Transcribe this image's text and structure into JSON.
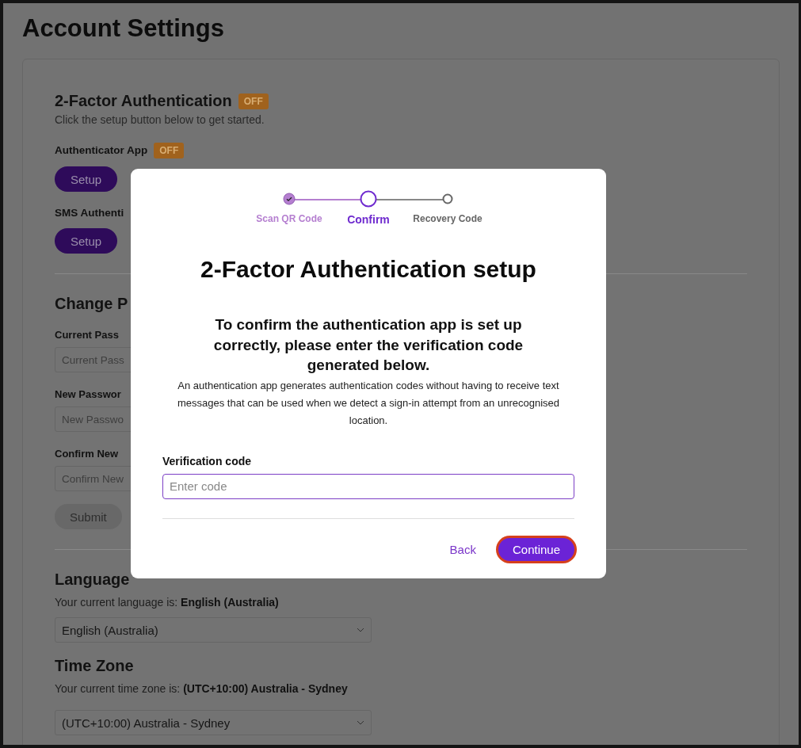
{
  "page_title": "Account Settings",
  "two_factor": {
    "title": "2-Factor Authentication",
    "status": "OFF",
    "hint": "Click the setup button below to get started.",
    "methods": [
      {
        "label": "Authenticator App",
        "status": "OFF",
        "button": "Setup"
      },
      {
        "label": "SMS Authenti",
        "button": "Setup"
      }
    ]
  },
  "change_password": {
    "title": "Change P",
    "fields": [
      {
        "label": "Current Pass",
        "placeholder": "Current Pass"
      },
      {
        "label": "New Passwor",
        "placeholder": "New Passwo"
      },
      {
        "label": "Confirm New",
        "placeholder": "Confirm New"
      }
    ],
    "submit": {
      "label": "Submit",
      "disabled": true
    }
  },
  "language": {
    "title": "Language",
    "current_prefix": "Your current language is:",
    "current": "English (Australia)",
    "value": "English (Australia)"
  },
  "time_zone": {
    "title": "Time Zone",
    "current_prefix": "Your current time zone is:",
    "current": "(UTC+10:00) Australia - Sydney",
    "value": "(UTC+10:00) Australia - Sydney"
  },
  "modal": {
    "steps": [
      {
        "label": "Scan QR Code",
        "completed": true,
        "selected": false
      },
      {
        "label": "Confirm",
        "completed": false,
        "selected": true
      },
      {
        "label": "Recovery Code",
        "completed": false,
        "selected": false
      }
    ],
    "title": "2-Factor Authentication setup",
    "lead": "To confirm the authentication app is set up correctly, please enter the verification code generated below.",
    "description": "An authentication app generates authentication codes without having to receive text messages that can be used when we detect a sign-in attempt from an unrecognised location.",
    "field_label": "Verification code",
    "placeholder": "Enter code",
    "buttons": [
      {
        "label": "Back",
        "kind": "link"
      },
      {
        "label": "Continue",
        "kind": "primary"
      }
    ]
  }
}
